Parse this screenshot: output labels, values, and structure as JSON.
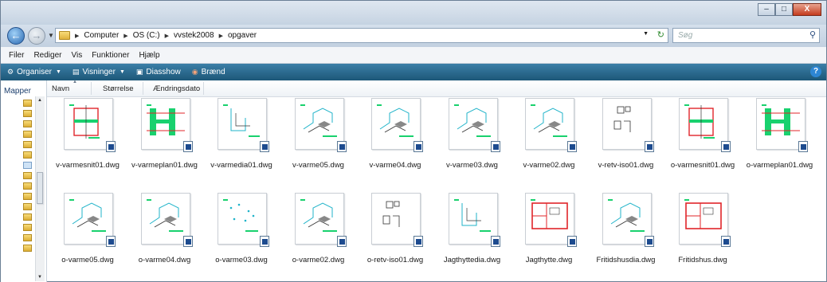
{
  "window": {
    "controls": {
      "minimize": "–",
      "maximize": "□",
      "close": "X"
    }
  },
  "address": {
    "crumbs": [
      "Computer",
      "OS (C:)",
      "vvstek2008",
      "opgaver"
    ],
    "search_placeholder": "Søg"
  },
  "menubar": {
    "items": [
      "Filer",
      "Rediger",
      "Vis",
      "Funktioner",
      "Hjælp"
    ]
  },
  "toolbar": {
    "organise": "Organiser",
    "views": "Visninger",
    "slideshow": "Diasshow",
    "burn": "Brænd",
    "help": "?"
  },
  "navpane": {
    "title": "Mapper"
  },
  "columns": {
    "name": "Navn",
    "size": "Størrelse",
    "modified": "Ændringsdato"
  },
  "files": [
    {
      "name": "v-varmesnit01.dwg",
      "kind": "section"
    },
    {
      "name": "v-varmeplan01.dwg",
      "kind": "plan"
    },
    {
      "name": "v-varmedia01.dwg",
      "kind": "dia"
    },
    {
      "name": "v-varme05.dwg",
      "kind": "iso"
    },
    {
      "name": "v-varme04.dwg",
      "kind": "iso"
    },
    {
      "name": "v-varme03.dwg",
      "kind": "iso"
    },
    {
      "name": "v-varme02.dwg",
      "kind": "iso"
    },
    {
      "name": "v-retv-iso01.dwg",
      "kind": "retv"
    },
    {
      "name": "o-varmesnit01.dwg",
      "kind": "section"
    },
    {
      "name": "o-varmeplan01.dwg",
      "kind": "plan"
    },
    {
      "name": "o-varme05.dwg",
      "kind": "iso"
    },
    {
      "name": "o-varme04.dwg",
      "kind": "iso"
    },
    {
      "name": "o-varme03.dwg",
      "kind": "dots"
    },
    {
      "name": "o-varme02.dwg",
      "kind": "iso"
    },
    {
      "name": "o-retv-iso01.dwg",
      "kind": "retv"
    },
    {
      "name": "Jagthyttedia.dwg",
      "kind": "dia"
    },
    {
      "name": "Jagthytte.dwg",
      "kind": "floor"
    },
    {
      "name": "Fritidshusdia.dwg",
      "kind": "iso"
    },
    {
      "name": "Fritidshus.dwg",
      "kind": "floor"
    }
  ],
  "colors": {
    "toolbar": "#2a6b90",
    "green": "#19d16e",
    "red": "#e0252a",
    "cyan": "#1fb3c9"
  }
}
